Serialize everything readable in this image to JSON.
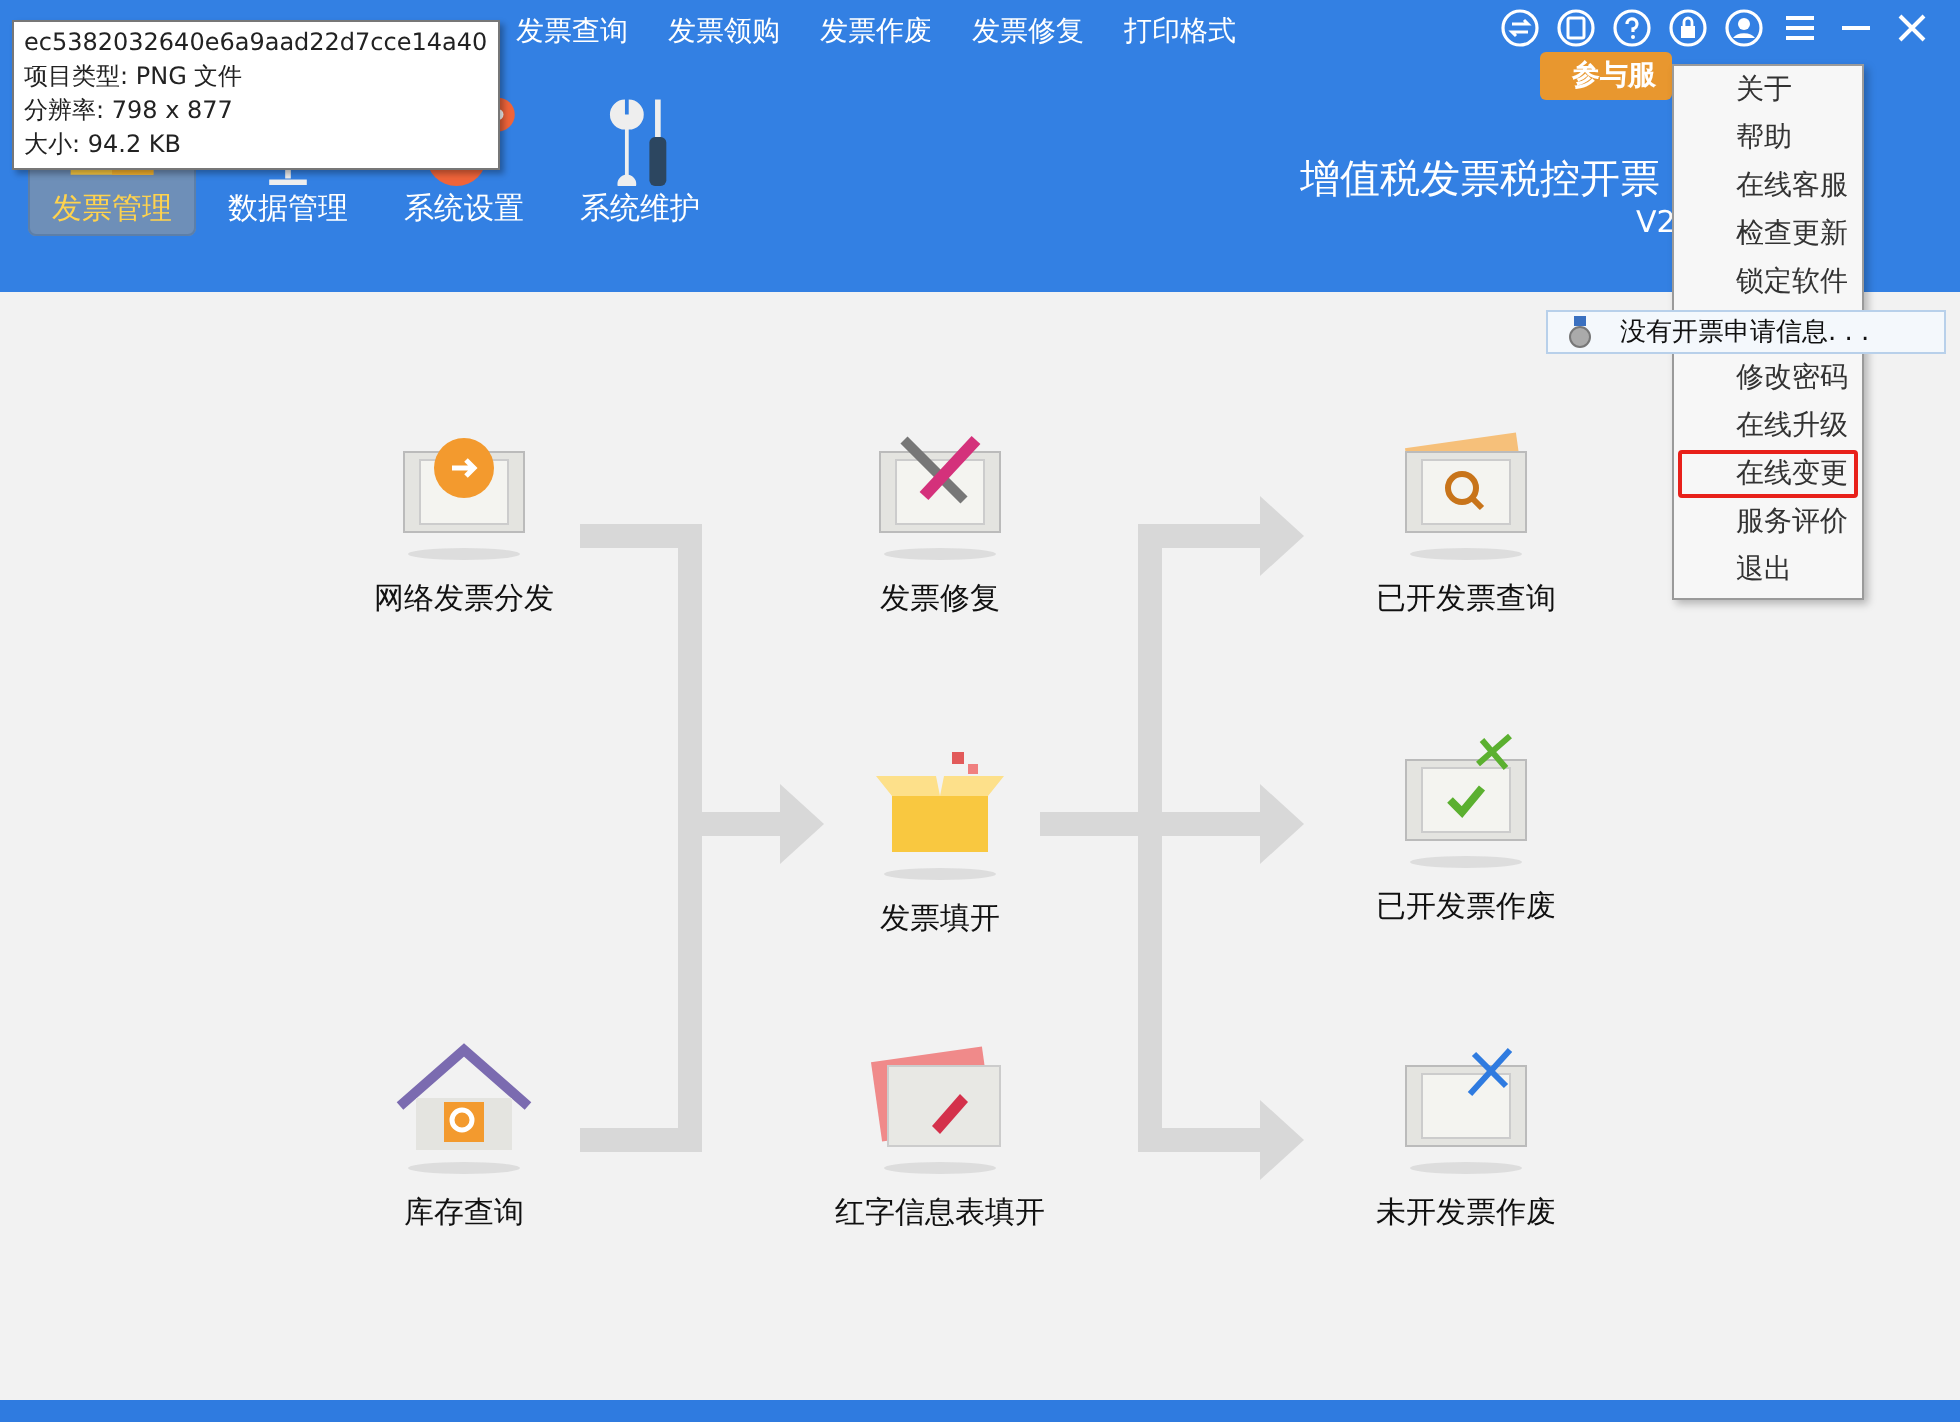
{
  "file_tooltip": {
    "lines": [
      "ec5382032640e6a9aad22d7cce14a40",
      "项目类型: PNG 文件",
      "分辨率: 798 x 877",
      "大小: 94.2 KB"
    ]
  },
  "top_menu": [
    "发票查询",
    "发票领购",
    "发票作废",
    "发票修复",
    "打印格式"
  ],
  "toolbar": [
    {
      "label": "发票管理",
      "kind": "box",
      "selected": true
    },
    {
      "label": "数据管理",
      "kind": "monitor",
      "selected": false
    },
    {
      "label": "系统设置",
      "kind": "gears",
      "selected": false
    },
    {
      "label": "系统维护",
      "kind": "tools",
      "selected": false
    }
  ],
  "app_title": "增值税发票税控开票",
  "version": "V2",
  "promo_badge": "参与服",
  "dropdown_menu": [
    {
      "label": "关于",
      "highlighted": false
    },
    {
      "label": "帮助",
      "highlighted": false
    },
    {
      "label": "在线客服",
      "highlighted": false
    },
    {
      "label": "检查更新",
      "highlighted": false
    },
    {
      "label": "锁定软件",
      "highlighted": false
    },
    {
      "label": "修改密码",
      "highlighted": false
    },
    {
      "label": "在线升级",
      "highlighted": false
    },
    {
      "label": "在线变更",
      "highlighted": true
    },
    {
      "label": "服务评价",
      "highlighted": false
    },
    {
      "label": "退出",
      "highlighted": false
    }
  ],
  "notification": "没有开票申请信息. . .",
  "flow_nodes": [
    {
      "label": "网络发票分发",
      "kind": "distribute"
    },
    {
      "label": "库存查询",
      "kind": "house"
    },
    {
      "label": "发票修复",
      "kind": "repair"
    },
    {
      "label": "发票填开",
      "kind": "open-box"
    },
    {
      "label": "红字信息表填开",
      "kind": "red-ticket"
    },
    {
      "label": "已开发票查询",
      "kind": "search-ticket"
    },
    {
      "label": "已开发票作废",
      "kind": "cut-check"
    },
    {
      "label": "未开发票作废",
      "kind": "cut-blank"
    }
  ]
}
